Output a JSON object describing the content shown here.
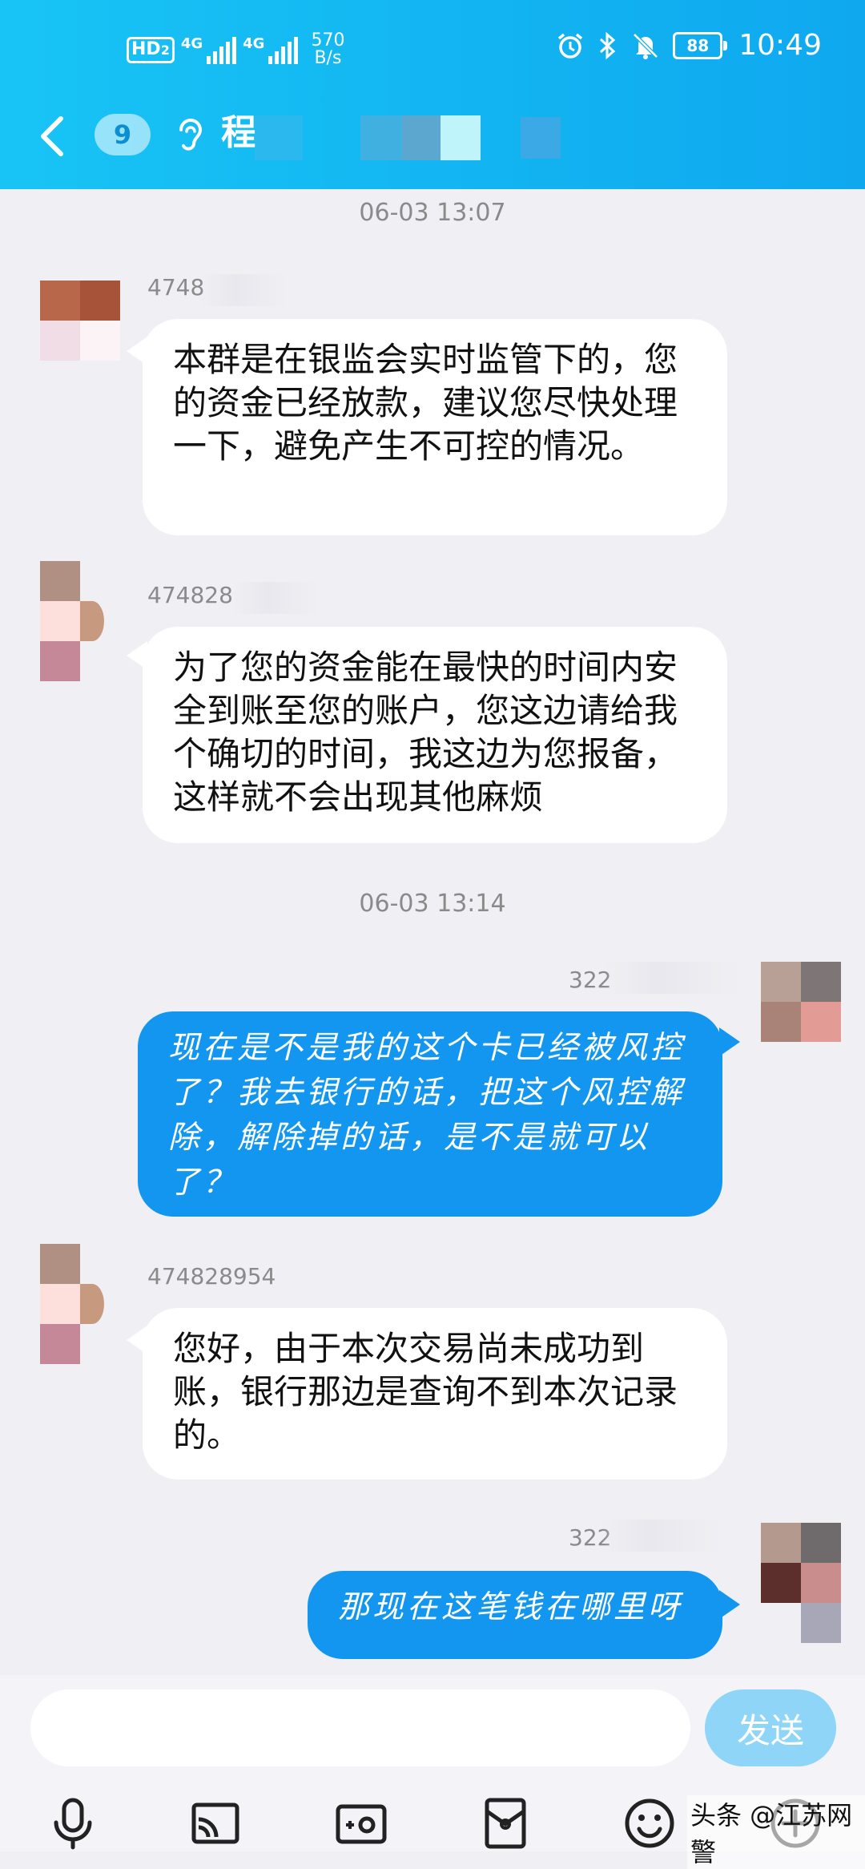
{
  "status_bar": {
    "hd_label": "HD",
    "hd_sub": "2",
    "signal1_label": "4G",
    "signal2_label": "4G",
    "net_speed_value": "570",
    "net_speed_unit": "B/s",
    "battery": "88",
    "time": "10:49"
  },
  "header": {
    "unread_count": "9",
    "chat_title": "程"
  },
  "messages": [
    {
      "type": "timestamp",
      "text": "06-03 13:07"
    },
    {
      "type": "incoming",
      "sender": "4748",
      "text": "本群是在银监会实时监管下的，您的资金已经放款，建议您尽快处理一下，避免产生不可控的情况。"
    },
    {
      "type": "incoming",
      "sender": "474828",
      "text": "为了您的资金能在最快的时间内安全到账至您的账户，您这边请给我个确切的时间，我这边为您报备，这样就不会出现其他麻烦"
    },
    {
      "type": "timestamp",
      "text": "06-03 13:14"
    },
    {
      "type": "outgoing",
      "sender": "322",
      "text": "现在是不是我的这个卡已经被风控了？我去银行的话，把这个风控解除，解除掉的话，是不是就可以了？"
    },
    {
      "type": "incoming",
      "sender": "474828954",
      "text": "您好，由于本次交易尚未成功到账，银行那边是查询不到本次记录的。"
    },
    {
      "type": "outgoing",
      "sender": "322",
      "text": "那现在这笔钱在哪里呀"
    }
  ],
  "input_bar": {
    "placeholder": "",
    "send_label": "发送"
  },
  "watermark": "头条 @江苏网警",
  "colors": {
    "header": "#12b3f1",
    "outgoing_bubble": "#1296f0",
    "incoming_bubble": "#ffffff",
    "background": "#efeff4",
    "send_button": "#8fd5f7"
  },
  "icons": [
    "back-chevron-icon",
    "ear-icon",
    "alarm-icon",
    "bluetooth-icon",
    "mute-bell-icon",
    "microphone-icon",
    "screen-cast-icon",
    "camera-icon",
    "red-packet-icon",
    "emoji-icon",
    "plus-icon"
  ]
}
